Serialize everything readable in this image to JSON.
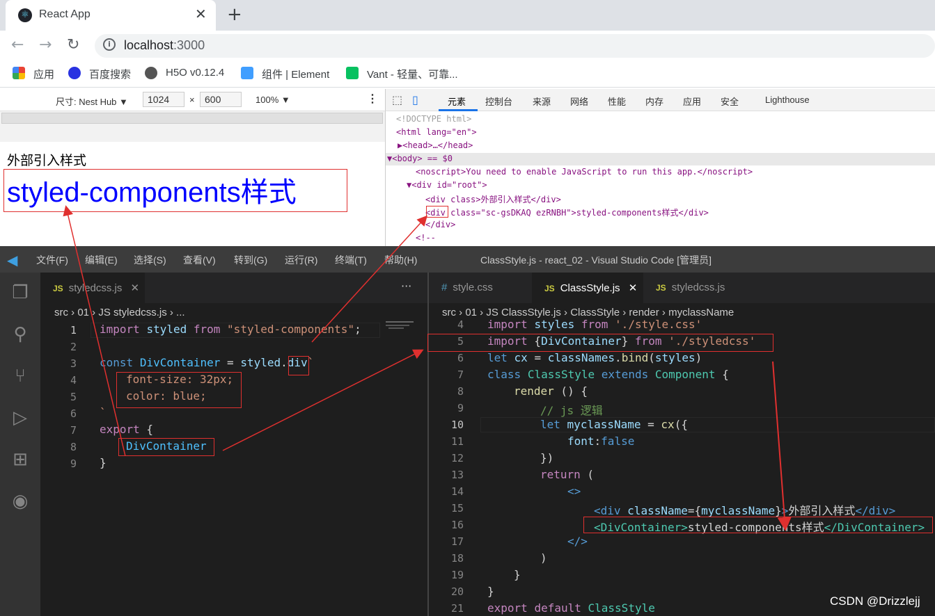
{
  "browser": {
    "tab_title": "React App",
    "tab_close": "✕",
    "new_tab": "+",
    "url_host": "localhost",
    "url_port": ":3000",
    "bookmarks": [
      "应用",
      "百度搜索",
      "H5O v0.12.4",
      "组件 | Element",
      "Vant - 轻量、可靠..."
    ]
  },
  "device_toolbar": {
    "device": "尺寸: Nest Hub ▼",
    "width": "1024",
    "times": "×",
    "height": "600",
    "zoom": "100% ▼"
  },
  "page": {
    "line1": "外部引入样式",
    "line2": "styled-components样式"
  },
  "devtools": {
    "tabs": [
      "元素",
      "控制台",
      "来源",
      "网络",
      "性能",
      "内存",
      "应用",
      "安全",
      "Lighthouse"
    ],
    "dom_lines": [
      "<!DOCTYPE html>",
      "<html lang=\"en\">",
      "▶<head>…</head>",
      "▼<body> == $0",
      "<noscript>You need to enable JavaScript to run this app.</noscript>",
      "▼<div id=\"root\">",
      "<div class>外部引入样式</div>",
      "<div class=\"sc-gsDKAQ ezRNBH\">styled-components样式</div>",
      "</div>",
      "<!--"
    ]
  },
  "vscode": {
    "menus": [
      "文件(F)",
      "编辑(E)",
      "选择(S)",
      "查看(V)",
      "转到(G)",
      "运行(R)",
      "终端(T)",
      "帮助(H)"
    ],
    "window_title": "ClassStyle.js - react_02 - Visual Studio Code [管理员]",
    "left_tab": "styledcss.js",
    "right_tabs": [
      "style.css",
      "ClassStyle.js",
      "styledcss.js"
    ],
    "left_breadcrumb": "src › 01 › JS styledcss.js › ...",
    "right_breadcrumb": "src › 01 › JS ClassStyle.js › ClassStyle › render › myclassName",
    "left_line_numbers": [
      "1",
      "2",
      "3",
      "4",
      "5",
      "6",
      "7",
      "8",
      "9"
    ],
    "right_line_numbers": [
      "4",
      "5",
      "6",
      "7",
      "8",
      "9",
      "10",
      "11",
      "12",
      "13",
      "14",
      "15",
      "16",
      "17",
      "18",
      "19",
      "20",
      "21"
    ]
  },
  "watermark": "CSDN @Drizzlejj"
}
